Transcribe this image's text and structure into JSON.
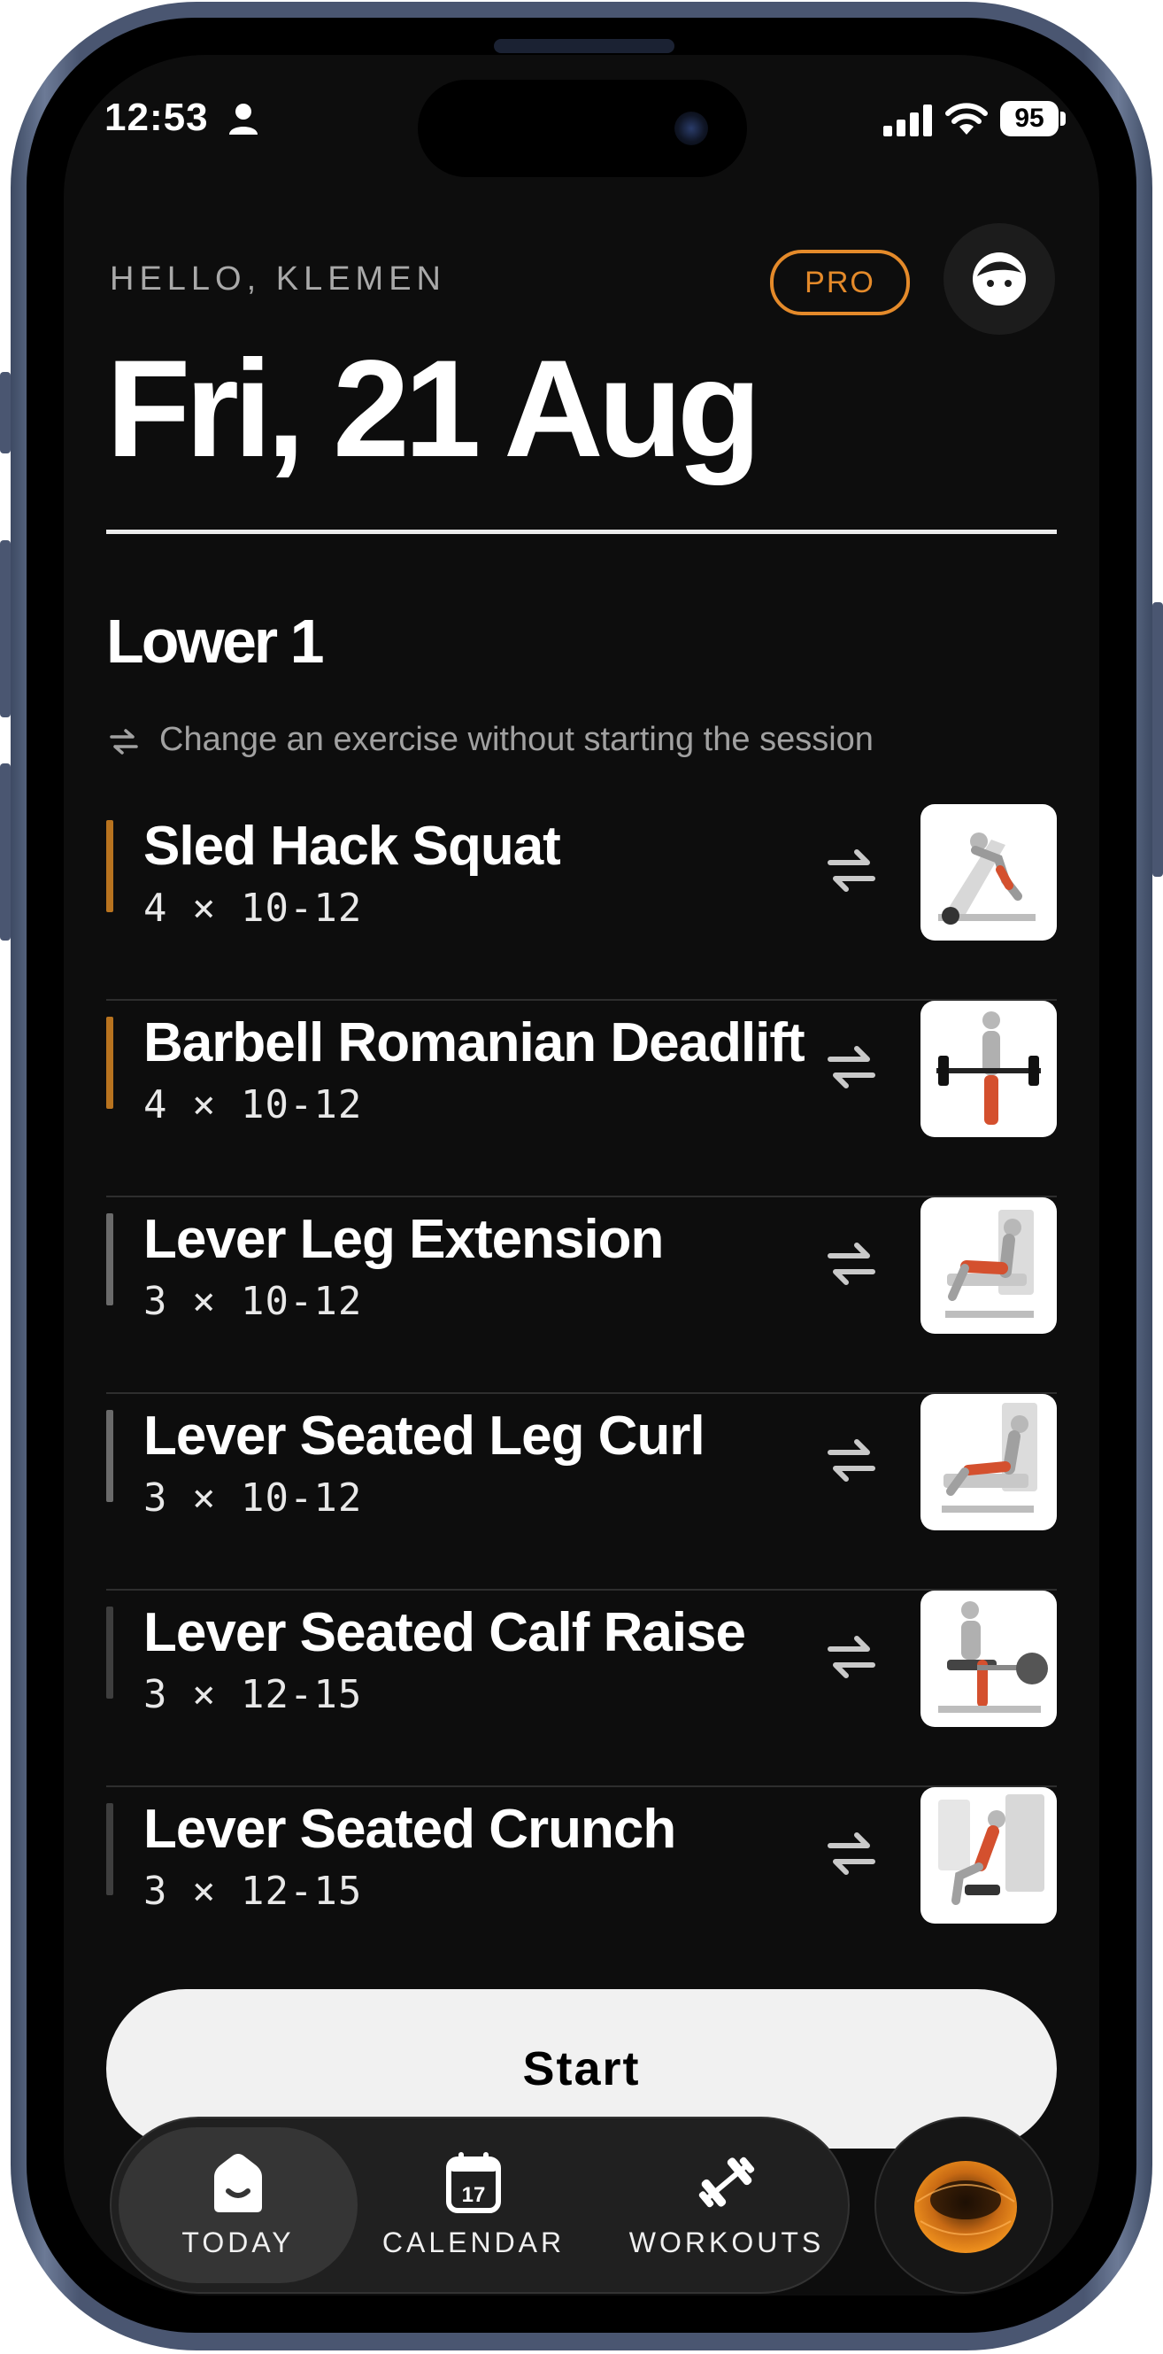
{
  "status_bar": {
    "time": "12:53",
    "battery": "95"
  },
  "header": {
    "greeting": "HELLO, KLEMEN",
    "pro_label": "PRO",
    "date": "Fri, 21 Aug"
  },
  "workout": {
    "name": "Lower 1",
    "hint": "Change an exercise without starting the session",
    "exercises": [
      {
        "name": "Sled Hack Squat",
        "sets": "4 × 10-12",
        "bar_color": "#b8731f"
      },
      {
        "name": "Barbell Romanian Deadlift",
        "sets": "4 × 10-12",
        "bar_color": "#b8731f"
      },
      {
        "name": "Lever Leg Extension",
        "sets": "3 × 10-12",
        "bar_color": "#6a6a6a"
      },
      {
        "name": "Lever Seated Leg Curl",
        "sets": "3 × 10-12",
        "bar_color": "#6a6a6a"
      },
      {
        "name": "Lever Seated Calf Raise",
        "sets": "3 × 12-15",
        "bar_color": "#3e3e3e"
      },
      {
        "name": "Lever Seated Crunch",
        "sets": "3 × 12-15",
        "bar_color": "#3e3e3e"
      }
    ],
    "start_label": "Start"
  },
  "tabbar": {
    "tabs": [
      {
        "label": "TODAY",
        "icon": "home-icon",
        "active": true
      },
      {
        "label": "CALENDAR",
        "icon": "calendar-icon",
        "active": false
      },
      {
        "label": "WORKOUTS",
        "icon": "dumbbell-icon",
        "active": false
      }
    ],
    "calendar_day": "17"
  },
  "colors": {
    "accent": "#e48a2a",
    "background": "#0d0d0d"
  }
}
